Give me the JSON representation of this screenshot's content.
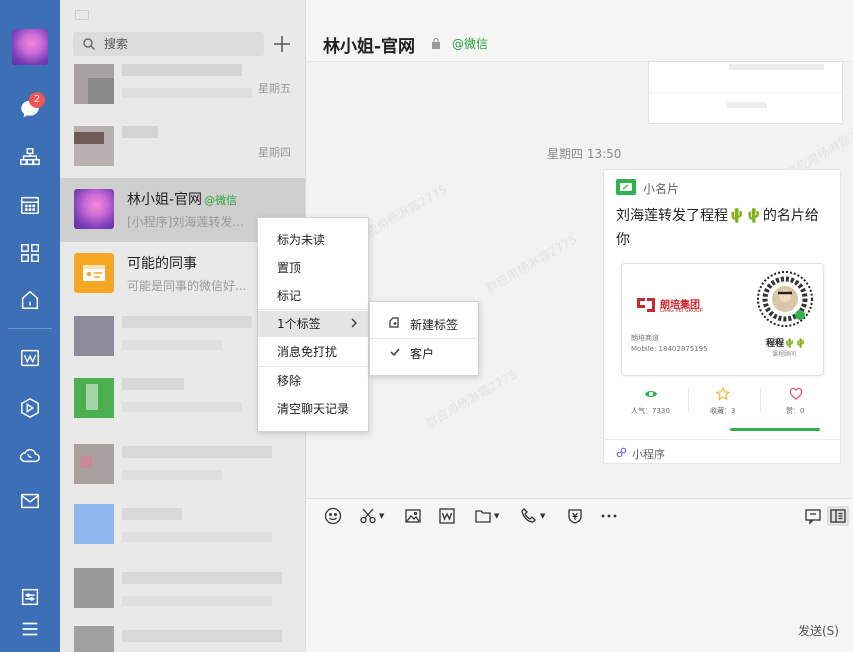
{
  "nav": {
    "unread_badge": "2",
    "icons": [
      "chat-icon",
      "contacts-icon",
      "calendar-icon",
      "mini-programs-icon",
      "home-icon",
      "weworkdoc-icon",
      "hexagon-app-icon",
      "phone-cloud-icon",
      "mail-icon",
      "settings-icon",
      "menu-icon"
    ]
  },
  "search": {
    "placeholder": "搜索"
  },
  "chats": [
    {
      "name": "",
      "preview": "",
      "time": "星期五"
    },
    {
      "name": "",
      "preview": "",
      "time": "星期四"
    },
    {
      "name": "林小姐-官网",
      "tag": "@微信",
      "preview": "[小程序]刘海莲转发...",
      "time": ""
    },
    {
      "name": "可能的同事",
      "preview": "可能是同事的微信好...",
      "time": ""
    }
  ],
  "header": {
    "title": "林小姐-官网",
    "tag": "@微信"
  },
  "conversation": {
    "timestamp": "星期四 13:50",
    "card": {
      "app_name": "小名片",
      "title": "刘海莲转发了程程🌵🌵的名片给你",
      "company_logo_name": "朗培集团",
      "company_logo_sub": "LANG PEI GROUP",
      "company": "朗培商道",
      "mobile": "Mobile: 18402875195",
      "person": "程程🌵🌵",
      "role": "课程顾问",
      "stats": [
        {
          "label": "人气：7330",
          "icon": "eye-icon",
          "color": "#2fb34f"
        },
        {
          "label": "收藏：3",
          "icon": "star-icon",
          "color": "#f3b63d"
        },
        {
          "label": "赞：0",
          "icon": "heart-icon",
          "color": "#e0566a"
        }
      ],
      "footer": "小程序"
    },
    "watermark": "群应用杨淋霜2775"
  },
  "context_menu": {
    "items": [
      "标为未读",
      "置顶",
      "标记",
      "1个标签",
      "消息免打扰",
      "移除",
      "清空聊天记录"
    ],
    "submenu": {
      "new_label": "新建标签",
      "checked_label": "客户"
    }
  },
  "input": {
    "send_label": "发送(S)"
  }
}
